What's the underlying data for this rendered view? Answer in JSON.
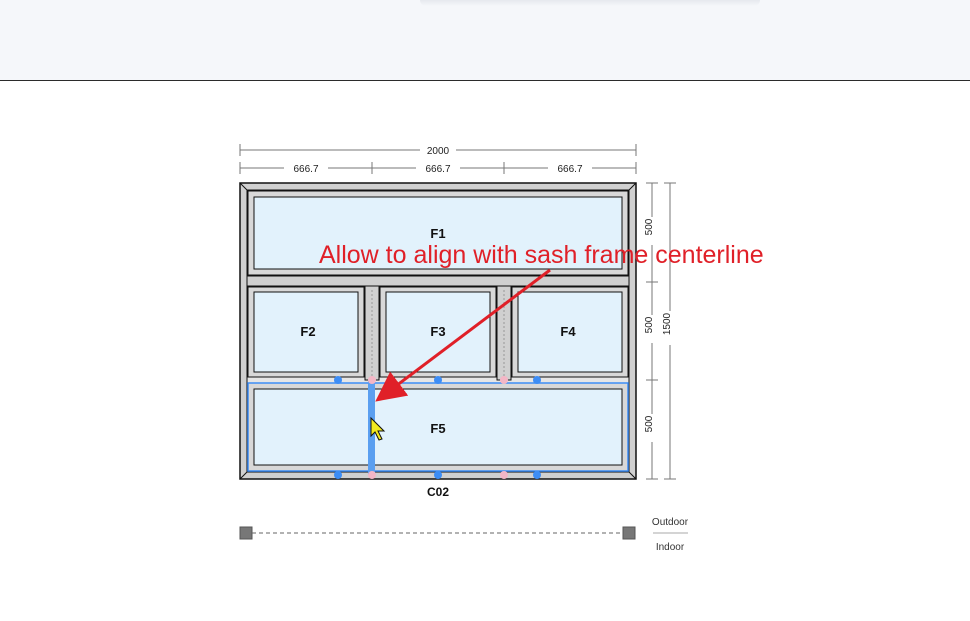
{
  "toolbar": {},
  "drawing": {
    "overall_width": "2000",
    "column_widths": [
      "666.7",
      "666.7",
      "666.7"
    ],
    "row_heights": [
      "500",
      "500",
      "500"
    ],
    "overall_height": "1500",
    "window_code": "C02",
    "panes": {
      "f1": "F1",
      "f2": "F2",
      "f3": "F3",
      "f4": "F4",
      "f5": "F5"
    },
    "side_labels": {
      "outdoor": "Outdoor",
      "indoor": "Indoor"
    }
  },
  "annotation": {
    "text": "Allow to align with sash frame centerline",
    "color": "#e02028"
  },
  "colors": {
    "glass": "#e2f2fc",
    "frame": "#d0d0d0",
    "selection": "#5a9ff0",
    "handle": "#3d8df5",
    "handle_alt": "#f4b6c6"
  }
}
